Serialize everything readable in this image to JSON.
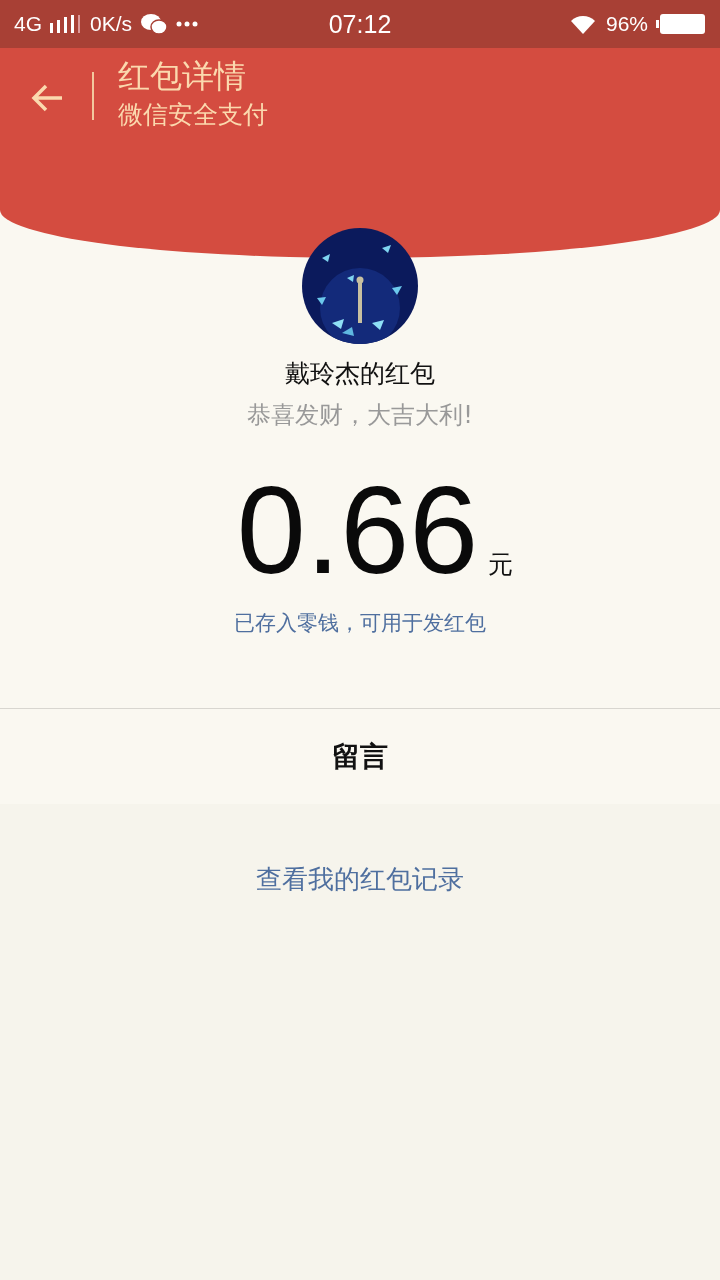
{
  "status_bar": {
    "network": "4G",
    "speed": "0K/s",
    "time": "07:12",
    "battery": "96%"
  },
  "header": {
    "title": "红包详情",
    "subtitle": "微信安全支付"
  },
  "sender": {
    "name": "戴玲杰的红包",
    "greeting": "恭喜发财，大吉大利!"
  },
  "amount": {
    "value": "0.66",
    "unit": "元"
  },
  "note": "已存入零钱，可用于发红包",
  "message_label": "留言",
  "record_link": "查看我的红包记录"
}
